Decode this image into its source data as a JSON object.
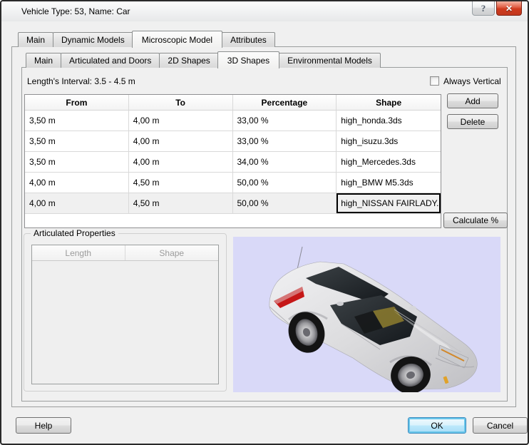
{
  "window": {
    "title": "Vehicle Type: 53, Name: Car",
    "help_glyph": "?",
    "close_glyph": "✕"
  },
  "main_tabs": [
    {
      "label": "Main",
      "active": false
    },
    {
      "label": "Dynamic Models",
      "active": false
    },
    {
      "label": "Microscopic Model",
      "active": true
    },
    {
      "label": "Attributes",
      "active": false
    }
  ],
  "sub_tabs": [
    {
      "label": "Main",
      "active": false
    },
    {
      "label": "Articulated and Doors",
      "active": false
    },
    {
      "label": "2D Shapes",
      "active": false
    },
    {
      "label": "3D Shapes",
      "active": true
    },
    {
      "label": "Environmental Models",
      "active": false
    }
  ],
  "shapes_panel": {
    "length_interval_label": "Length's Interval: 3.5 - 4.5 m",
    "always_vertical": {
      "label": "Always Vertical",
      "checked": false
    },
    "table": {
      "columns": [
        "From",
        "To",
        "Percentage",
        "Shape"
      ],
      "rows": [
        {
          "from": "3,50 m",
          "to": "4,00 m",
          "percentage": "33,00 %",
          "shape": "high_honda.3ds"
        },
        {
          "from": "3,50 m",
          "to": "4,00 m",
          "percentage": "33,00 %",
          "shape": "high_isuzu.3ds"
        },
        {
          "from": "3,50 m",
          "to": "4,00 m",
          "percentage": "34,00 %",
          "shape": "high_Mercedes.3ds"
        },
        {
          "from": "4,00 m",
          "to": "4,50 m",
          "percentage": "50,00 %",
          "shape": "high_BMW M5.3ds"
        },
        {
          "from": "4,00 m",
          "to": "4,50 m",
          "percentage": "50,00 %",
          "shape": "high_NISSAN FAIRLADY..."
        }
      ],
      "selected_row_index": 4,
      "selected_cell_column": "Shape"
    },
    "buttons": {
      "add": "Add",
      "delete": "Delete",
      "calculate": "Calculate %"
    }
  },
  "articulated_properties": {
    "title": "Articulated Properties",
    "columns": [
      "Length",
      "Shape"
    ],
    "rows": []
  },
  "preview": {
    "model_shown": "high_NISSAN FAIRLADY",
    "background_color": "#d9d9f8",
    "car_body_color": "#d8d8da",
    "taillight_color": "#c51717"
  },
  "footer_buttons": {
    "help": "Help",
    "ok": "OK",
    "cancel": "Cancel"
  }
}
